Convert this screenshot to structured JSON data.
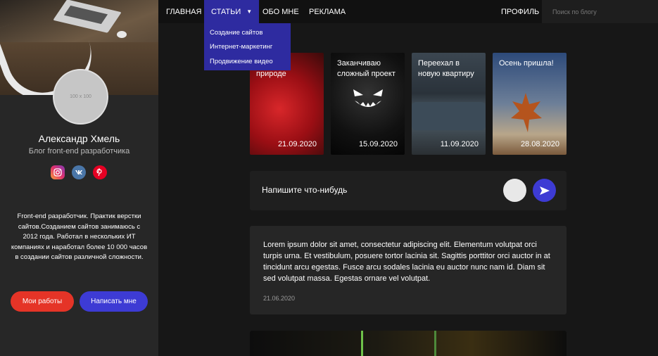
{
  "nav": {
    "items": [
      "ГЛАВНАЯ",
      "СТАТЬИ",
      "ОБО МНЕ",
      "РЕКЛАМА"
    ],
    "profile": "ПРОФИЛЬ",
    "search_placeholder": "Поиск по блогу"
  },
  "dropdown": {
    "items": [
      "Создание сайтов",
      "Интернет-маркетинг",
      "Продвижение видео"
    ]
  },
  "sidebar": {
    "avatar_placeholder": "100 x 100",
    "name": "Александр Хмель",
    "subtitle": "Блог front-end разработчика",
    "socials": [
      "instagram-icon",
      "vk-icon",
      "pinterest-icon"
    ],
    "bio": "Front-end разработчик. Практик верстки сайтов.Созданием сайтов занимаюсь с 2012 года. Работал в нескольких ИТ компаниях и наработал более 10 000 часов в создании сайтов различной сложности.",
    "btn_works": "Мои работы",
    "btn_write": "Написать мне"
  },
  "stories": [
    {
      "title": "Я на природе",
      "date": "21.09.2020"
    },
    {
      "title": "Заканчиваю сложный проект",
      "date": "15.09.2020"
    },
    {
      "title": "Переехал в новую квартиру",
      "date": "11.09.2020"
    },
    {
      "title": "Осень пришла!",
      "date": "28.08.2020"
    }
  ],
  "compose": {
    "placeholder": "Напишите что-нибудь"
  },
  "post": {
    "text": "Lorem ipsum dolor sit amet, consectetur adipiscing elit. Elementum volutpat orci turpis urna. Et vestibulum, posuere tortor lacinia sit. Sagittis porttitor orci auctor in at tincidunt arcu egestas. Fusce arcu sodales lacinia eu auctor nunc nam id. Diam sit sed volutpat massa. Egestas ornare vel volutpat.",
    "date": "21.06.2020"
  },
  "colors": {
    "accent_blue": "#3d3bd4",
    "accent_red": "#e53427",
    "nav_active": "#2e2ba0"
  }
}
